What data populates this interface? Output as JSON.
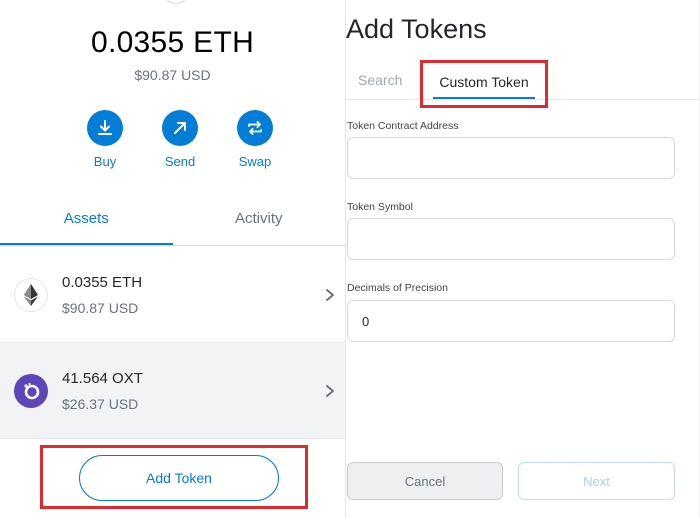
{
  "wallet": {
    "balance": "0.0355 ETH",
    "balance_usd": "$90.87 USD",
    "actions": [
      {
        "label": "Buy",
        "icon": "download-icon"
      },
      {
        "label": "Send",
        "icon": "arrow-up-right-icon"
      },
      {
        "label": "Swap",
        "icon": "swap-icon"
      }
    ],
    "tabs": [
      {
        "label": "Assets",
        "active": true
      },
      {
        "label": "Activity",
        "active": false
      }
    ],
    "assets": [
      {
        "amount": "0.0355 ETH",
        "usd": "$90.87 USD",
        "icon": "ethereum-icon"
      },
      {
        "amount": "41.564 OXT",
        "usd": "$26.37 USD",
        "icon": "orchid-icon"
      }
    ],
    "add_token_label": "Add Token"
  },
  "add_tokens": {
    "title": "Add Tokens",
    "tabs": {
      "search": "Search",
      "custom": "Custom Token"
    },
    "fields": {
      "contract_label": "Token Contract Address",
      "contract_value": "",
      "symbol_label": "Token Symbol",
      "symbol_value": "",
      "decimals_label": "Decimals of Precision",
      "decimals_value": "0"
    },
    "cancel_label": "Cancel",
    "next_label": "Next"
  },
  "colors": {
    "primary": "#037dd6",
    "highlight": "#e12a2f",
    "oxt": "#5f45ba"
  }
}
